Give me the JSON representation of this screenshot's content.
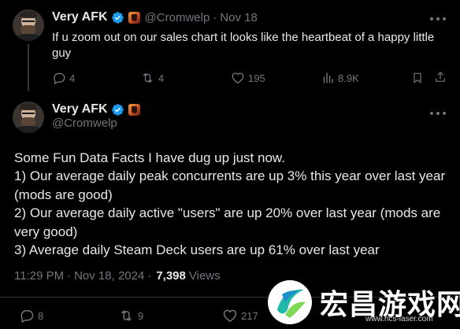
{
  "parent_tweet": {
    "display_name": "Very AFK",
    "handle": "@Cromwelp",
    "separator": "·",
    "date": "Nov 18",
    "text": "If u zoom out on our sales chart it looks like the heartbeat of a happy little guy",
    "replies": "4",
    "reposts": "4",
    "likes": "195",
    "views": "8.9K"
  },
  "main_tweet": {
    "display_name": "Very AFK",
    "handle": "@Cromwelp",
    "lines": [
      "Some Fun Data Facts I have dug up just now.",
      "1) Our average daily peak concurrents are up 3% this year over last year (mods are good)",
      "2) Our average daily active \"users\" are up 20% over last year (mods are very good)",
      "3) Average daily Steam Deck users are up 61% over last year"
    ],
    "time": "11:29 PM",
    "separator": "·",
    "date": "Nov 18, 2024",
    "views_count": "7,398",
    "views_label": "Views",
    "replies": "8",
    "reposts": "9",
    "likes": "217"
  },
  "watermark": {
    "text": "宏昌游戏网",
    "url": "www.hcs-laser.com"
  },
  "icons": {
    "verified": "verified-badge-icon",
    "affiliate": "affiliate-badge-icon",
    "more": "more-icon",
    "reply": "reply-icon",
    "repost": "repost-icon",
    "like": "like-icon",
    "views": "views-icon",
    "bookmark": "bookmark-icon",
    "share": "share-icon"
  },
  "colors": {
    "background": "#000000",
    "text": "#e7e9ea",
    "muted": "#71767b",
    "verified": "#1d9bf0",
    "divider": "#2f3336"
  }
}
